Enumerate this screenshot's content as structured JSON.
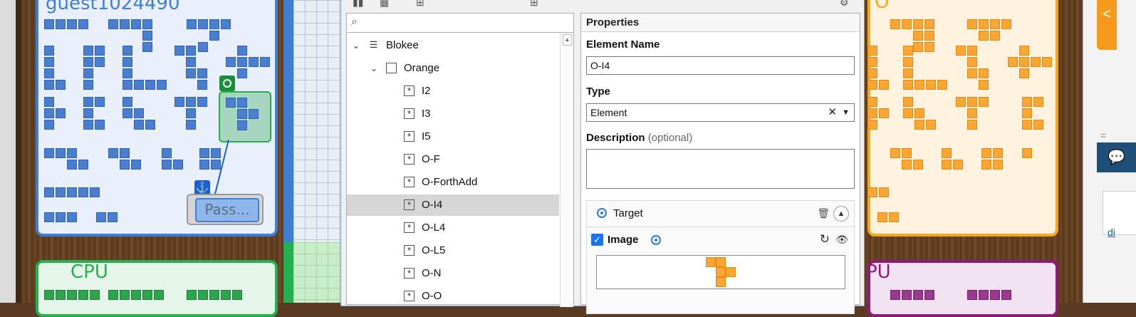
{
  "game": {
    "blue_player_name": "guest1024490",
    "cpu_player_name": "CPU",
    "orange_player_name": "O",
    "purple_player_name": "PU",
    "pass_label": "Pass..."
  },
  "dialog": {
    "tree": {
      "search_placeholder": "",
      "root": "Blokee",
      "group": "Orange",
      "items": [
        "I2",
        "I3",
        "I5",
        "O-F",
        "O-ForthAdd",
        "O-I4",
        "O-L4",
        "O-L5",
        "O-N",
        "O-O"
      ],
      "selected": "O-I4"
    },
    "properties": {
      "header": "Properties",
      "element_name_label": "Element Name",
      "element_name_value": "O-I4",
      "type_label": "Type",
      "type_value": "Element",
      "description_label": "Description",
      "description_optional": "(optional)",
      "description_value": "",
      "target_label": "Target",
      "image_label": "Image",
      "image_checked": true
    }
  },
  "sidebar_right": {
    "link_text": "di",
    "collapse_glyph": "<"
  },
  "colors": {
    "blue": "#3f7fd3",
    "green": "#22b14c",
    "orange": "#f5a623",
    "purple": "#8e1b7a",
    "accent": "#1a73e8"
  },
  "icons": [
    "search-icon",
    "chevron-down-icon",
    "document-icon",
    "frame-icon",
    "asterisk-icon",
    "target-icon",
    "trash-icon",
    "collapse-up-icon",
    "checkbox-icon",
    "refresh-icon",
    "eye-icon",
    "anchor-icon",
    "chat-icon"
  ]
}
